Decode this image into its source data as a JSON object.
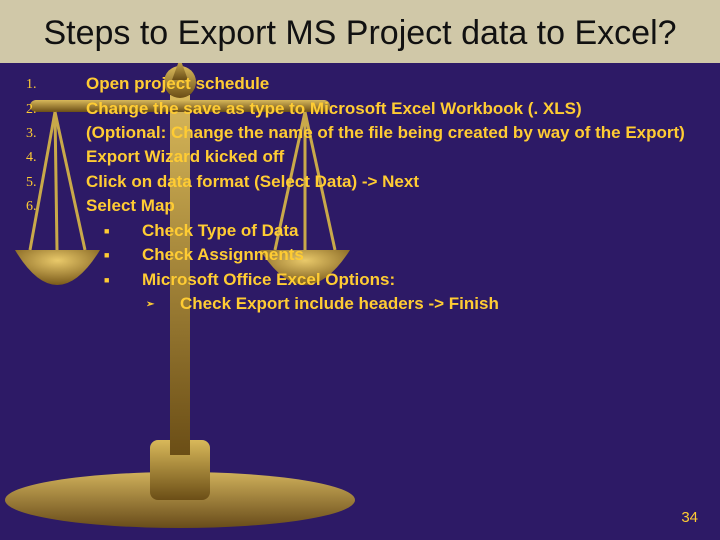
{
  "title": "Steps to Export MS Project data to Excel?",
  "steps": [
    "Open project schedule",
    "Change the save as type to Microsoft Excel Workbook (. XLS)",
    "(Optional: Change the name of the file being created by way of the Export)",
    "Export Wizard kicked off",
    "Click on data format (Select Data) -> Next",
    "Select Map"
  ],
  "sub1": [
    "Check Type of Data",
    "Check Assignments",
    "Microsoft Office Excel Options:"
  ],
  "sub2": [
    "Check Export include headers -> Finish"
  ],
  "numbers": [
    "1.",
    "2.",
    "3.",
    "4.",
    "5.",
    "6."
  ],
  "page_number": "34"
}
